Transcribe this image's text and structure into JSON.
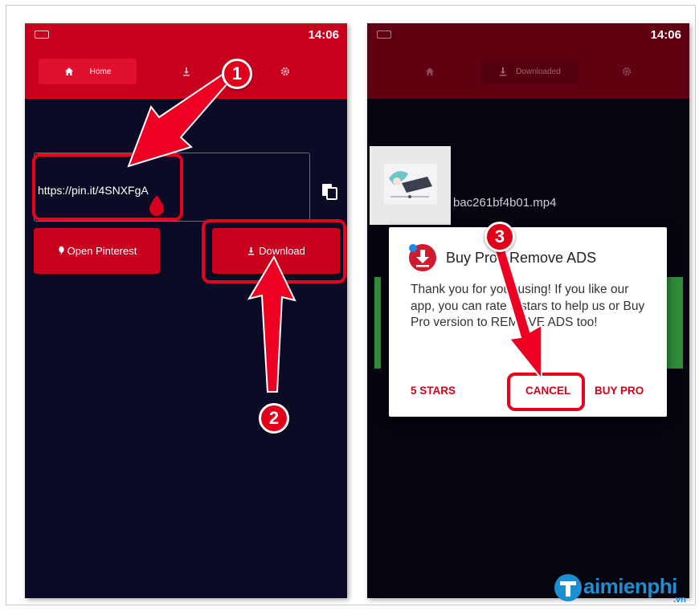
{
  "status_bar": {
    "time_left": "14:06",
    "time_right": "14:06"
  },
  "left_screen": {
    "tabs": {
      "home_label": "Home"
    },
    "url_field": {
      "value": "https://pin.it/4SNXFgA"
    },
    "open_pinterest_label": "Open Pinterest",
    "download_label": "Download"
  },
  "right_screen": {
    "tabs": {
      "downloaded_label": "Downloaded"
    },
    "file_name": "bac261bf4b01.mp4"
  },
  "dialog": {
    "title": "Buy Pro / Remove ADS",
    "body": "Thank you for your using! If you like our app, you can rate 5 stars to help us or Buy Pro version to REMOVE ADS too!",
    "actions": {
      "five_stars": "5 STARS",
      "cancel": "CANCEL",
      "buy_pro": "BUY PRO"
    }
  },
  "annotations": {
    "step1": "1",
    "step2": "2",
    "step3": "3"
  },
  "watermark": {
    "brand": "aimienphi",
    "tld": ".vn"
  },
  "colors": {
    "accent": "#c8001e",
    "accent_dark": "#610011",
    "background": "#0c0b26",
    "annotation_red": "#e8001c",
    "watermark_blue": "#1b8fd1"
  }
}
